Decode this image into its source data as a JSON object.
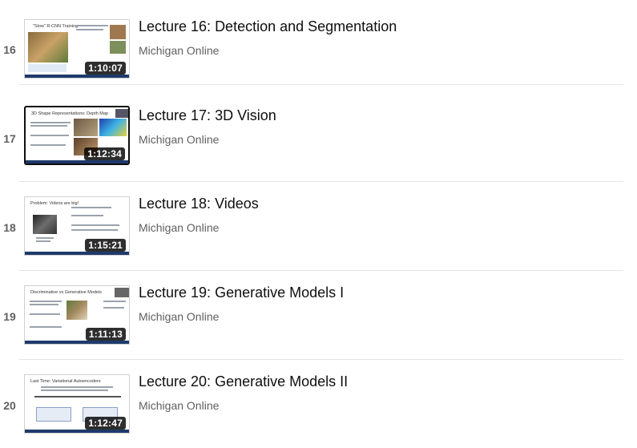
{
  "playlist": {
    "items": [
      {
        "index": "16",
        "title": "Lecture 16: Detection and Segmentation",
        "channel": "Michigan Online",
        "duration": "1:10:07",
        "slide_title": "\"Slow\" R-CNN Training",
        "active": false
      },
      {
        "index": "17",
        "title": "Lecture 17: 3D Vision",
        "channel": "Michigan Online",
        "duration": "1:12:34",
        "slide_title": "3D Shape Representations: Depth Map",
        "active": true
      },
      {
        "index": "18",
        "title": "Lecture 18: Videos",
        "channel": "Michigan Online",
        "duration": "1:15:21",
        "slide_title": "Problem: Videos are big!",
        "active": false
      },
      {
        "index": "19",
        "title": "Lecture 19: Generative Models I",
        "channel": "Michigan Online",
        "duration": "1:11:13",
        "slide_title": "Discriminative vs Generative Models",
        "active": false
      },
      {
        "index": "20",
        "title": "Lecture 20: Generative Models II",
        "channel": "Michigan Online",
        "duration": "1:12:47",
        "slide_title": "Last Time: Variational Autoencoders",
        "active": false
      }
    ]
  }
}
